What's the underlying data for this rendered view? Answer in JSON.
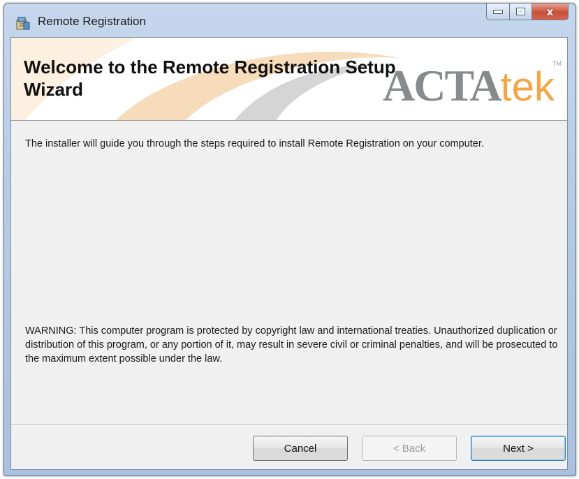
{
  "window": {
    "title": "Remote Registration",
    "icon": "installer-package-icon"
  },
  "controls": {
    "minimize_icon": "minimize-icon",
    "maximize_icon": "maximize-icon",
    "close_glyph": "x"
  },
  "banner": {
    "title": "Welcome to the Remote Registration Setup Wizard",
    "logo_primary": "ACTA",
    "logo_secondary": "tek",
    "logo_mark": "TM",
    "colors": {
      "logo_gray": "#878b8c",
      "logo_orange": "#f3a548"
    }
  },
  "body": {
    "intro": "The installer will guide you through the steps required to install Remote Registration on your computer.",
    "warning": "WARNING: This computer program is protected by copyright law and international treaties. Unauthorized duplication or distribution of this program, or any portion of it, may result in severe civil or criminal penalties, and will be prosecuted to the maximum extent possible under the law."
  },
  "buttons": {
    "cancel": "Cancel",
    "back": "< Back",
    "next": "Next >"
  }
}
